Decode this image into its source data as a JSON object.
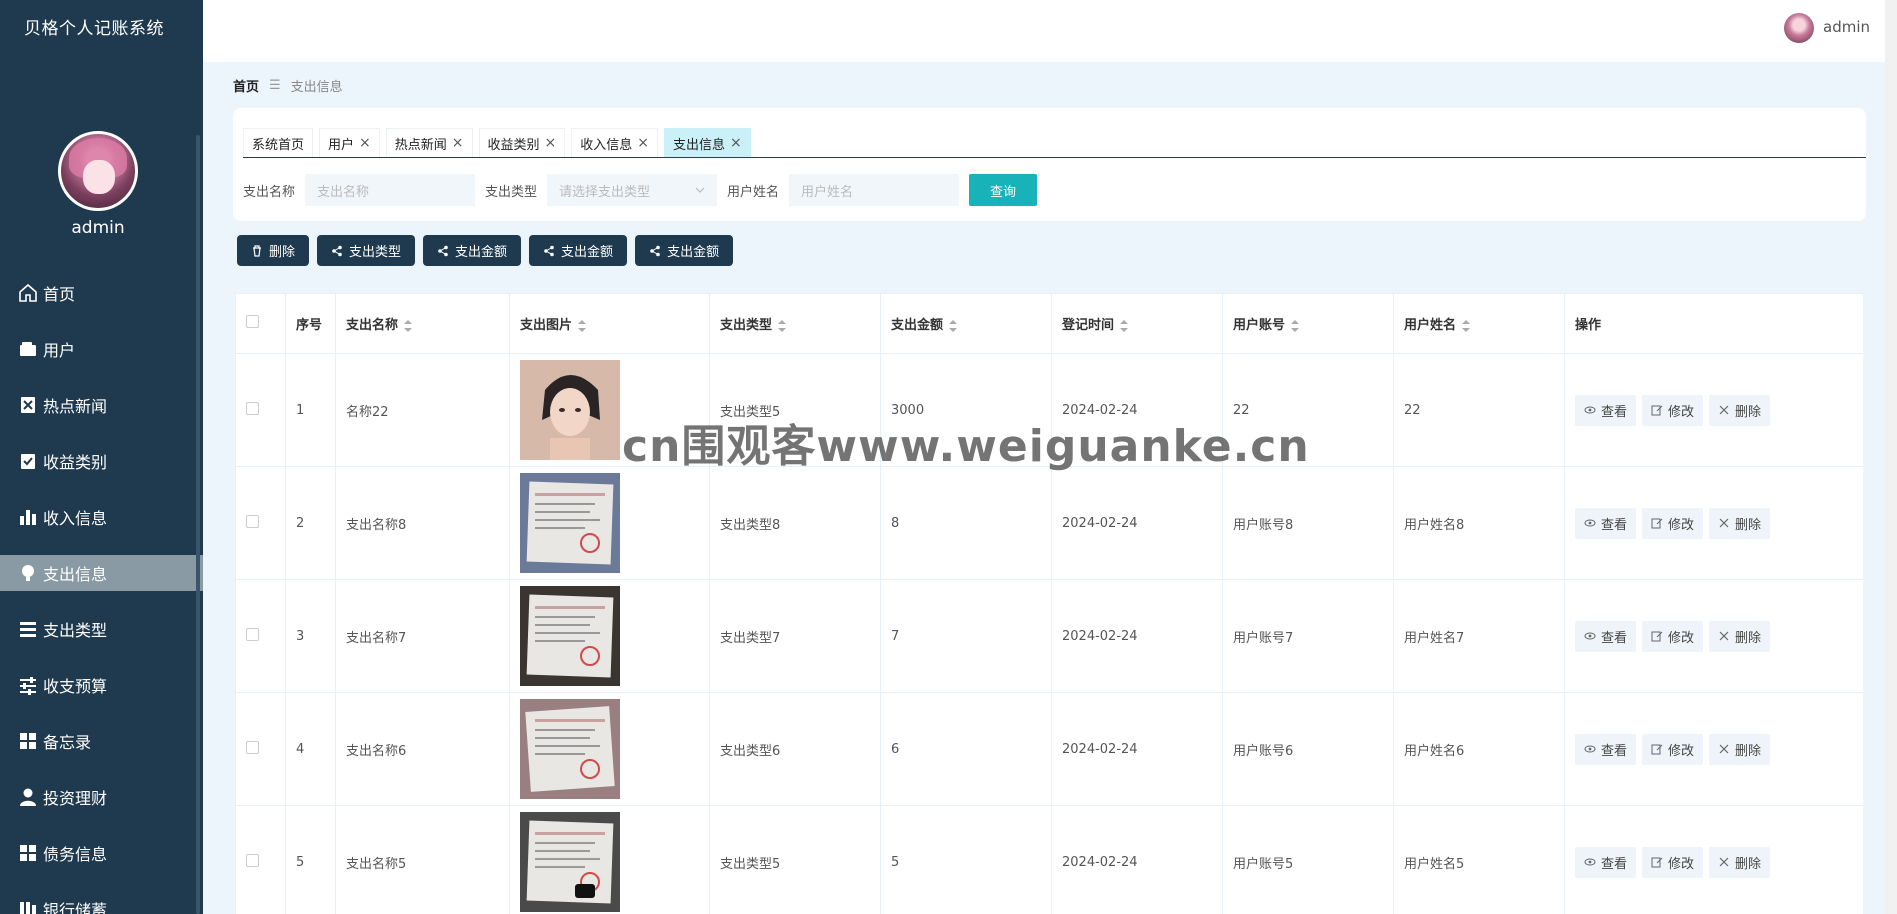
{
  "app": {
    "title": "贝格个人记账系统",
    "user": "admin"
  },
  "sidebar": {
    "username": "admin",
    "items": [
      {
        "label": "首页",
        "icon": "home-icon"
      },
      {
        "label": "用户",
        "icon": "wallet-icon"
      },
      {
        "label": "热点新闻",
        "icon": "news-icon"
      },
      {
        "label": "收益类别",
        "icon": "clipboard-check-icon"
      },
      {
        "label": "收入信息",
        "icon": "bar-chart-icon"
      },
      {
        "label": "支出信息",
        "icon": "bulb-icon",
        "active": true
      },
      {
        "label": "支出类型",
        "icon": "list-icon"
      },
      {
        "label": "收支预算",
        "icon": "sliders-icon"
      },
      {
        "label": "备忘录",
        "icon": "grid-icon"
      },
      {
        "label": "投资理财",
        "icon": "user-icon"
      },
      {
        "label": "债务信息",
        "icon": "grid-icon"
      },
      {
        "label": "银行储蓄",
        "icon": "bank-icon"
      }
    ]
  },
  "breadcrumb": {
    "home": "首页",
    "separator": "☰",
    "current": "支出信息"
  },
  "tabs": [
    {
      "label": "系统首页",
      "closable": false
    },
    {
      "label": "用户",
      "closable": true
    },
    {
      "label": "热点新闻",
      "closable": true
    },
    {
      "label": "收益类别",
      "closable": true
    },
    {
      "label": "收入信息",
      "closable": true
    },
    {
      "label": "支出信息",
      "closable": true,
      "active": true
    }
  ],
  "filters": {
    "name_label": "支出名称",
    "name_placeholder": "支出名称",
    "type_label": "支出类型",
    "type_placeholder": "请选择支出类型",
    "user_label": "用户姓名",
    "user_placeholder": "用户姓名",
    "search_label": "查询"
  },
  "actions": [
    "删除",
    "支出类型",
    "支出金额",
    "支出金额",
    "支出金额"
  ],
  "table": {
    "headers": [
      "序号",
      "支出名称",
      "支出图片",
      "支出类型",
      "支出金额",
      "登记时间",
      "用户账号",
      "用户姓名",
      "操作"
    ],
    "rows": [
      {
        "no": "1",
        "name": "名称22",
        "type": "支出类型5",
        "amount": "3000",
        "date": "2024-02-24",
        "account": "22",
        "username": "22",
        "img": "portrait"
      },
      {
        "no": "2",
        "name": "支出名称8",
        "type": "支出类型8",
        "amount": "8",
        "date": "2024-02-24",
        "account": "用户账号8",
        "username": "用户姓名8",
        "img": "receipt-blue"
      },
      {
        "no": "3",
        "name": "支出名称7",
        "type": "支出类型7",
        "amount": "7",
        "date": "2024-02-24",
        "account": "用户账号7",
        "username": "用户姓名7",
        "img": "receipt-dark"
      },
      {
        "no": "4",
        "name": "支出名称6",
        "type": "支出类型6",
        "amount": "6",
        "date": "2024-02-24",
        "account": "用户账号6",
        "username": "用户姓名6",
        "img": "receipt-pink"
      },
      {
        "no": "5",
        "name": "支出名称5",
        "type": "支出类型5",
        "amount": "5",
        "date": "2024-02-24",
        "account": "用户账号5",
        "username": "用户姓名5",
        "img": "receipt-desk"
      }
    ],
    "ops": {
      "view": "查看",
      "edit": "修改",
      "delete": "删除"
    }
  },
  "watermark": "cn围观客www.weiguanke.cn",
  "colors": {
    "sidebar": "#1f3a4f",
    "accent": "#17b3b8",
    "active_tab": "#c9f1f7"
  }
}
